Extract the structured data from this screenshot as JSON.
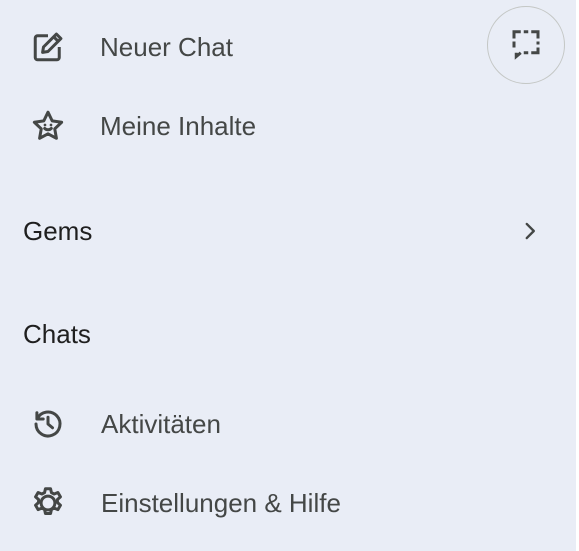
{
  "sidebar": {
    "new_chat": {
      "label": "Neuer Chat",
      "icon": "edit-icon"
    },
    "my_content": {
      "label": "Meine Inhalte",
      "icon": "star-face-icon"
    },
    "gems": {
      "label": "Gems",
      "icon": "chevron-right-icon"
    },
    "chats": {
      "label": "Chats"
    },
    "activity": {
      "label": "Aktivitäten",
      "icon": "history-icon"
    },
    "settings": {
      "label": "Einstellungen & Hilfe",
      "icon": "gear-icon"
    }
  },
  "top_right_button": {
    "icon": "dashed-chat-icon"
  },
  "colors": {
    "background": "#e9edf6",
    "label": "#444746",
    "heading": "#1f1f1f",
    "icon": "#444746"
  }
}
